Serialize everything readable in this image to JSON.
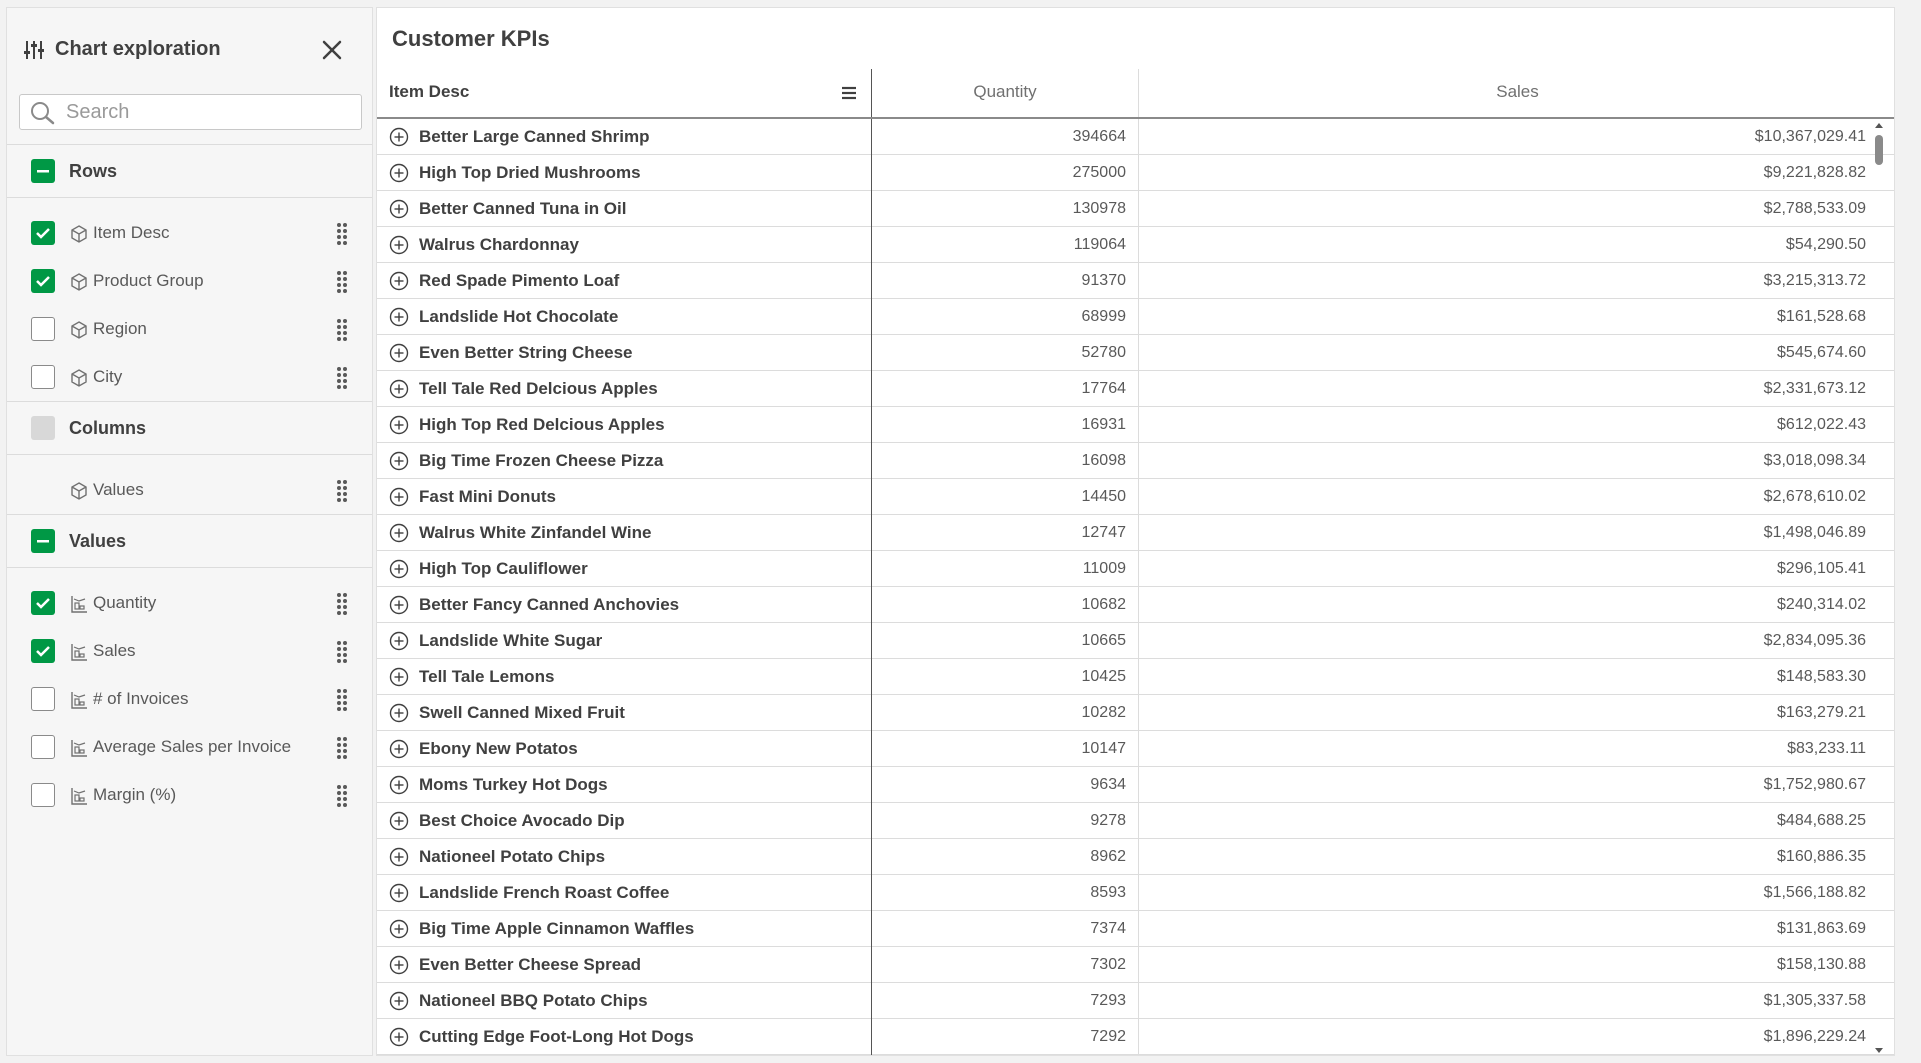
{
  "panel": {
    "title": "Chart exploration",
    "search_placeholder": "Search",
    "rows_label": "Rows",
    "columns_label": "Columns",
    "values_label": "Values",
    "rows_items": [
      {
        "label": "Item Desc",
        "checked": true
      },
      {
        "label": "Product Group",
        "checked": true
      },
      {
        "label": "Region",
        "checked": false
      },
      {
        "label": "City",
        "checked": false
      }
    ],
    "columns_items": [
      {
        "label": "Values"
      }
    ],
    "values_items": [
      {
        "label": "Quantity",
        "checked": true
      },
      {
        "label": "Sales",
        "checked": true
      },
      {
        "label": "# of Invoices",
        "checked": false
      },
      {
        "label": "Average Sales per Invoice",
        "checked": false
      },
      {
        "label": "Margin (%)",
        "checked": false
      }
    ]
  },
  "main": {
    "title": "Customer KPIs",
    "headers": {
      "item": "Item Desc",
      "quantity": "Quantity",
      "sales": "Sales"
    },
    "rows": [
      {
        "item": "Better Large Canned Shrimp",
        "quantity": "394664",
        "sales": "$10,367,029.41"
      },
      {
        "item": "High Top Dried Mushrooms",
        "quantity": "275000",
        "sales": "$9,221,828.82"
      },
      {
        "item": "Better Canned Tuna in Oil",
        "quantity": "130978",
        "sales": "$2,788,533.09"
      },
      {
        "item": "Walrus Chardonnay",
        "quantity": "119064",
        "sales": "$54,290.50"
      },
      {
        "item": "Red Spade Pimento Loaf",
        "quantity": "91370",
        "sales": "$3,215,313.72"
      },
      {
        "item": "Landslide Hot Chocolate",
        "quantity": "68999",
        "sales": "$161,528.68"
      },
      {
        "item": "Even Better String Cheese",
        "quantity": "52780",
        "sales": "$545,674.60"
      },
      {
        "item": "Tell Tale Red Delcious Apples",
        "quantity": "17764",
        "sales": "$2,331,673.12"
      },
      {
        "item": "High Top Red Delcious Apples",
        "quantity": "16931",
        "sales": "$612,022.43"
      },
      {
        "item": "Big Time Frozen Cheese Pizza",
        "quantity": "16098",
        "sales": "$3,018,098.34"
      },
      {
        "item": "Fast Mini Donuts",
        "quantity": "14450",
        "sales": "$2,678,610.02"
      },
      {
        "item": "Walrus White Zinfandel Wine",
        "quantity": "12747",
        "sales": "$1,498,046.89"
      },
      {
        "item": "High Top Cauliflower",
        "quantity": "11009",
        "sales": "$296,105.41"
      },
      {
        "item": "Better Fancy Canned Anchovies",
        "quantity": "10682",
        "sales": "$240,314.02"
      },
      {
        "item": "Landslide White Sugar",
        "quantity": "10665",
        "sales": "$2,834,095.36"
      },
      {
        "item": "Tell Tale Lemons",
        "quantity": "10425",
        "sales": "$148,583.30"
      },
      {
        "item": "Swell Canned Mixed Fruit",
        "quantity": "10282",
        "sales": "$163,279.21"
      },
      {
        "item": "Ebony New Potatos",
        "quantity": "10147",
        "sales": "$83,233.11"
      },
      {
        "item": "Moms Turkey Hot Dogs",
        "quantity": "9634",
        "sales": "$1,752,980.67"
      },
      {
        "item": "Best Choice Avocado Dip",
        "quantity": "9278",
        "sales": "$484,688.25"
      },
      {
        "item": "Nationeel Potato Chips",
        "quantity": "8962",
        "sales": "$160,886.35"
      },
      {
        "item": "Landslide French Roast Coffee",
        "quantity": "8593",
        "sales": "$1,566,188.82"
      },
      {
        "item": "Big Time Apple Cinnamon Waffles",
        "quantity": "7374",
        "sales": "$131,863.69"
      },
      {
        "item": "Even Better Cheese Spread",
        "quantity": "7302",
        "sales": "$158,130.88"
      },
      {
        "item": "Nationeel BBQ Potato Chips",
        "quantity": "7293",
        "sales": "$1,305,337.58"
      },
      {
        "item": "Cutting Edge Foot-Long Hot Dogs",
        "quantity": "7292",
        "sales": "$1,896,229.24"
      }
    ]
  },
  "colors": {
    "accent_green": "#009845",
    "text_dark": "#404040",
    "border": "#dcdcdc"
  }
}
